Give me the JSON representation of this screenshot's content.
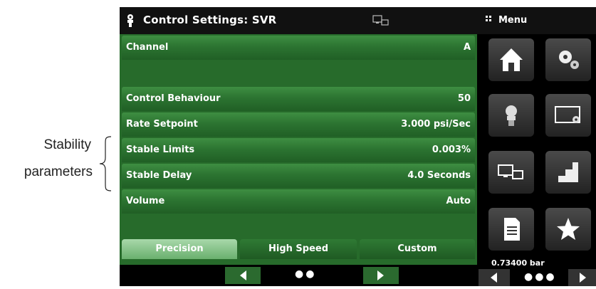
{
  "annotation": {
    "line1": "Stability",
    "line2": "parameters"
  },
  "header": {
    "title": "Control Settings: SVR",
    "menu_label": "Menu"
  },
  "rows": [
    {
      "label": "Channel",
      "value": "A"
    },
    {
      "label": "Control Behaviour",
      "value": "50"
    },
    {
      "label": "Rate Setpoint",
      "value": "3.000 psi/Sec"
    },
    {
      "label": "Stable Limits",
      "value": "0.003%"
    },
    {
      "label": "Stable Delay",
      "value": "4.0 Seconds"
    },
    {
      "label": "Volume",
      "value": "Auto"
    }
  ],
  "modes": [
    "Precision",
    "High Speed",
    "Custom"
  ],
  "selected_mode": "Precision",
  "pager": {
    "dots": "●●"
  },
  "side": {
    "icons": [
      "home-icon",
      "settings-icon",
      "control-icon",
      "display-settings-icon",
      "remote-icon",
      "step-icon",
      "document-icon",
      "favorite-icon"
    ],
    "reading": "0.73400  bar",
    "dots": "●●●"
  }
}
